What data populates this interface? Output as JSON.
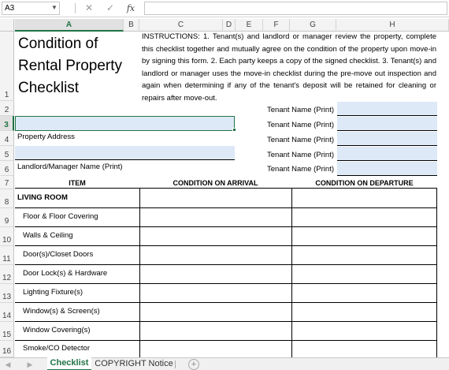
{
  "formula_bar": {
    "name_box": "A3",
    "cancel_icon": "✕",
    "enter_icon": "✓",
    "fx_label": "fx",
    "formula": ""
  },
  "columns": [
    "A",
    "B",
    "C",
    "D",
    "E",
    "F",
    "G",
    "H"
  ],
  "selected_column": "A",
  "rows": [
    "1",
    "2",
    "3",
    "4",
    "5",
    "6",
    "7",
    "8",
    "9",
    "10",
    "11",
    "12",
    "13",
    "14",
    "15",
    "16"
  ],
  "selected_row": "3",
  "sheet": {
    "title_lines": [
      "Condition of",
      "Rental Property",
      "Checklist"
    ],
    "instructions": "INSTRUCTIONS:  1. Tenant(s) and landlord or manager review the property, complete this checklist together and mutually agree on the condition of the property upon move-in by signing this form. 2. Each party keeps a copy of the signed checklist. 3. Tenant(s) and landlord or manager uses the move-in checklist during the pre-move out inspection and again when determining if any of the tenant's deposit will be retained for cleaning or repairs after move-out.",
    "property_address_label": "Property Address",
    "landlord_label": "Landlord/Manager Name (Print)",
    "tenant_labels": [
      "Tenant Name (Print)",
      "Tenant Name (Print)",
      "Tenant Name (Print)",
      "Tenant Name (Print)",
      "Tenant Name (Print)"
    ],
    "table_headers": {
      "item": "ITEM",
      "arrival": "CONDITION ON ARRIVAL",
      "departure": "CONDITION ON DEPARTURE"
    },
    "section": "LIVING ROOM",
    "items": [
      "Floor & Floor Covering",
      "Walls & Ceiling",
      "Door(s)/Closet Doors",
      "Door Lock(s) & Hardware",
      "Lighting Fixture(s)",
      "Window(s) & Screen(s)",
      "Window Covering(s)",
      "Smoke/CO Detector"
    ]
  },
  "tabs": {
    "prev_arrow": "◀",
    "next_arrow": "▶",
    "active": "Checklist",
    "other": "COPYRIGHT Notice",
    "add_icon": "+"
  },
  "colors": {
    "accent": "#217346",
    "input_fill": "#dde9f7"
  }
}
